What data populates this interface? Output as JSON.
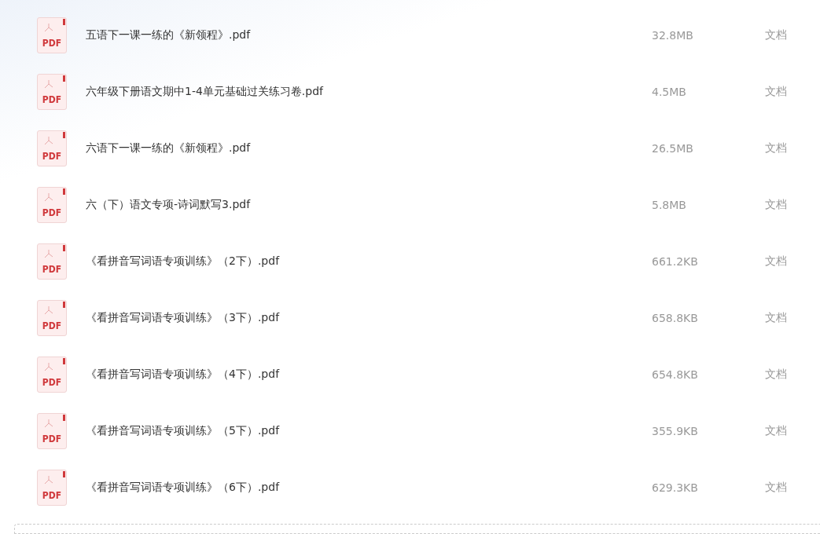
{
  "files": [
    {
      "icon_label": "PDF",
      "name": "五语下一课一练的《新领程》.pdf",
      "size": "32.8MB",
      "type": "文档"
    },
    {
      "icon_label": "PDF",
      "name": "六年级下册语文期中1-4单元基础过关练习卷.pdf",
      "size": "4.5MB",
      "type": "文档"
    },
    {
      "icon_label": "PDF",
      "name": "六语下一课一练的《新领程》.pdf",
      "size": "26.5MB",
      "type": "文档"
    },
    {
      "icon_label": "PDF",
      "name": "六（下）语文专项-诗词默写3.pdf",
      "size": "5.8MB",
      "type": "文档"
    },
    {
      "icon_label": "PDF",
      "name": "《看拼音写词语专项训练》（2下）.pdf",
      "size": "661.2KB",
      "type": "文档"
    },
    {
      "icon_label": "PDF",
      "name": "《看拼音写词语专项训练》（3下）.pdf",
      "size": "658.8KB",
      "type": "文档"
    },
    {
      "icon_label": "PDF",
      "name": "《看拼音写词语专项训练》（4下）.pdf",
      "size": "654.8KB",
      "type": "文档"
    },
    {
      "icon_label": "PDF",
      "name": "《看拼音写词语专项训练》（5下）.pdf",
      "size": "355.9KB",
      "type": "文档"
    },
    {
      "icon_label": "PDF",
      "name": "《看拼音写词语专项训练》（6下）.pdf",
      "size": "629.3KB",
      "type": "文档"
    }
  ]
}
